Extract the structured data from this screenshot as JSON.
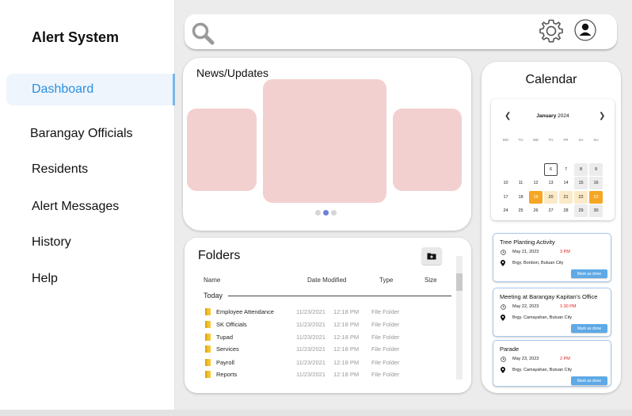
{
  "sidebar": {
    "app_title": "Alert System",
    "items": [
      {
        "label": "Dashboard",
        "active": true
      },
      {
        "label": "Barangay Officials"
      },
      {
        "label": "Residents"
      },
      {
        "label": "Alert Messages"
      },
      {
        "label": "History"
      },
      {
        "label": "Help"
      }
    ]
  },
  "topbar": {
    "icons": [
      "search-icon",
      "gear-icon",
      "user-avatar-icon"
    ]
  },
  "news": {
    "title": "News/Updates",
    "slide_count": 3,
    "active_slide": 2
  },
  "folders": {
    "title": "Folders",
    "columns": [
      "Name",
      "Date Modified",
      "Type",
      "Size"
    ],
    "group_label": "Today",
    "rows": [
      {
        "name": "Employee Attendance",
        "date": "11/23/2021",
        "time": "12:18 PM",
        "type": "File Folder"
      },
      {
        "name": "SK Officials",
        "date": "11/23/2021",
        "time": "12:18 PM",
        "type": "File Folder"
      },
      {
        "name": "Tupad",
        "date": "11/23/2021",
        "time": "12:18 PM",
        "type": "File Folder"
      },
      {
        "name": "Services",
        "date": "11/23/2021",
        "time": "12:18 PM",
        "type": "File Folder"
      },
      {
        "name": "Payroll",
        "date": "11/23/2021",
        "time": "12:18 PM",
        "type": "File Folder"
      },
      {
        "name": "Reports",
        "date": "11/23/2021",
        "time": "12:18 PM",
        "type": "File Folder"
      }
    ]
  },
  "calendar": {
    "title": "Calendar",
    "month": "January",
    "year": "2024",
    "weekdays": [
      "MO",
      "TU",
      "WE",
      "TH",
      "FR",
      "SA",
      "SU"
    ],
    "weeks": [
      [
        "",
        "",
        "",
        "",
        "",
        "",
        ""
      ],
      [
        "",
        "",
        "",
        "6",
        "7",
        "8",
        "9"
      ],
      [
        "10",
        "11",
        "12",
        "13",
        "14",
        "15",
        "16"
      ],
      [
        "17",
        "18",
        "19",
        "20",
        "21",
        "22",
        "23"
      ],
      [
        "24",
        "25",
        "26",
        "27",
        "28",
        "29",
        "30"
      ]
    ],
    "today": "6",
    "range": {
      "start": "19",
      "end": "23"
    }
  },
  "events": [
    {
      "title": "Tree Planting Activity",
      "date": "May 21, 2023",
      "time": "3 PM",
      "location": "Brgy. Bonbon, Butuan City",
      "button": "Mark as done"
    },
    {
      "title": "Meeting at Barangay Kapitan's Office",
      "date": "May 22, 2023",
      "time": "1:30 PM",
      "location": "Brgy. Camayahan, Butuan City",
      "button": "Mark as done"
    },
    {
      "title": "Parade",
      "date": "May 23, 2023",
      "time": "2 PM",
      "location": "Brgy. Camayahan, Butuan City",
      "button": "Mark as done"
    }
  ],
  "colors": {
    "accent": "#2b8fe0",
    "slide": "#f3d0d0",
    "range_end": "#f5a623",
    "range_mid": "#fbeac8",
    "event_time": "#e02020",
    "event_button": "#5ea9e6"
  }
}
